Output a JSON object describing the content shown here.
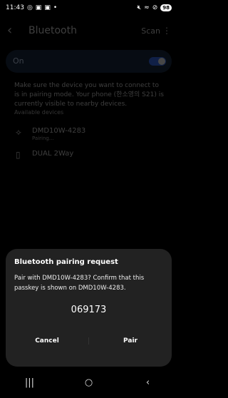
{
  "status": {
    "time": "11:43",
    "icons_left": [
      "screen-record-icon",
      "notification-icon",
      "notification-icon"
    ],
    "dot": "•",
    "icons_right": [
      "mute-icon",
      "wifi-icon",
      "alarm-icon"
    ],
    "battery_level": "98"
  },
  "header": {
    "title": "Bluetooth",
    "scan_label": "Scan",
    "back_glyph": "‹",
    "more_glyph": "⋮"
  },
  "bluetooth": {
    "toggle_label": "On",
    "enabled": true
  },
  "description": "Make sure the device you want to connect to is in pairing mode. Your phone (한소영의 S21) is currently visible to nearby devices.",
  "available_devices": {
    "section_title": "Available devices",
    "items": [
      {
        "name": "DMD10W-4283",
        "status": "Pairing...",
        "icon": "bluetooth-device-icon",
        "glyph": "⟡"
      },
      {
        "name": "DUAL 2Way",
        "status": "",
        "icon": "phone-device-icon",
        "glyph": "▯"
      }
    ]
  },
  "pairing_dialog": {
    "title": "Bluetooth pairing request",
    "message": "Pair with DMD10W-4283? Confirm that this passkey is shown on DMD10W-4283.",
    "passkey": "069173",
    "cancel_label": "Cancel",
    "pair_label": "Pair"
  },
  "navigation": {
    "recents_glyph": "|||",
    "home_glyph": "○",
    "back_glyph": "‹"
  },
  "colors": {
    "background": "#000000",
    "dialog_bg": "#222222",
    "accent": "#3b74ff"
  }
}
